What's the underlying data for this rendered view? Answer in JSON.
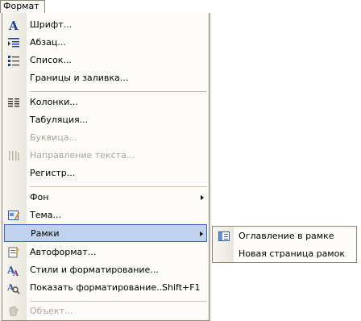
{
  "menu_title": "Формат",
  "items": [
    {
      "label": "Шрифт...",
      "icon": "font-a-icon"
    },
    {
      "label": "Абзац...",
      "icon": "paragraph-icon"
    },
    {
      "label": "Список...",
      "icon": "list-icon"
    },
    {
      "label": "Границы и заливка...",
      "icon": ""
    },
    {
      "label": "Колонки...",
      "icon": "columns-icon"
    },
    {
      "label": "Табуляция...",
      "icon": ""
    },
    {
      "label": "Буквица...",
      "icon": "",
      "disabled": true
    },
    {
      "label": "Направление текста...",
      "icon": "text-direction-icon",
      "disabled": true
    },
    {
      "label": "Регистр...",
      "icon": ""
    },
    {
      "label": "Фон",
      "icon": "",
      "submenu": true
    },
    {
      "label": "Тема...",
      "icon": "theme-icon"
    },
    {
      "label": "Рамки",
      "icon": "",
      "submenu": true,
      "highlighted": true
    },
    {
      "label": "Автоформат...",
      "icon": "autoformat-icon"
    },
    {
      "label": "Стили и форматирование...",
      "icon": "styles-icon"
    },
    {
      "label": "Показать форматирование...",
      "icon": "reveal-formatting-icon",
      "shortcut": "Shift+F1"
    },
    {
      "label": "Объект...",
      "icon": "object-icon",
      "disabled": true
    }
  ],
  "submenu": [
    {
      "label": "Оглавление в рамке",
      "icon": "frames-toc-icon"
    },
    {
      "label": "Новая страница рамок",
      "icon": ""
    }
  ],
  "colors": {
    "highlight": "#c1d2ee",
    "highlight_border": "#316ac5",
    "disabled": "#a7a59a"
  }
}
